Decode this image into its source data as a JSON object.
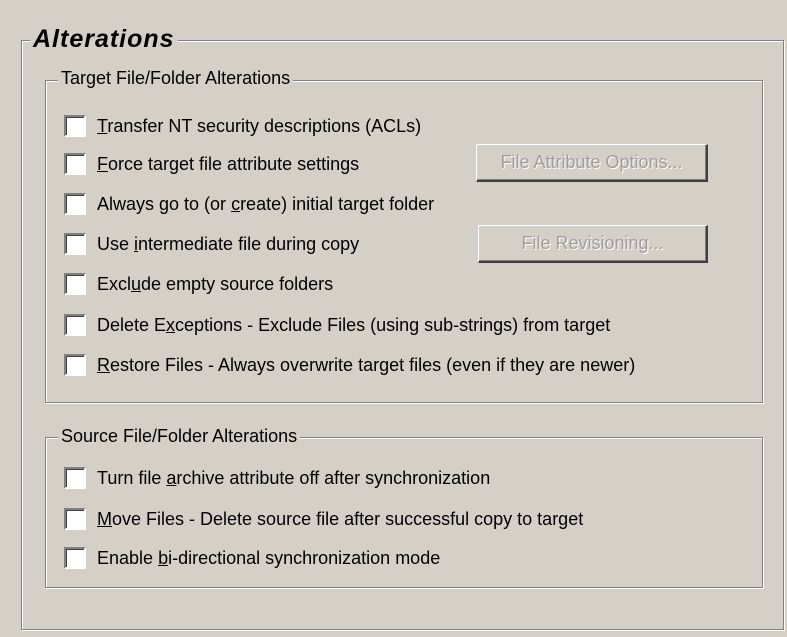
{
  "group_title": "Alterations",
  "target": {
    "title": "Target File/Folder Alterations",
    "options": [
      {
        "pre": "",
        "u": "T",
        "post": "ransfer NT security descriptions (ACLs)",
        "checked": false
      },
      {
        "pre": "",
        "u": "F",
        "post": "orce target file attribute settings",
        "checked": false
      },
      {
        "pre": "Always go to (or ",
        "u": "c",
        "post": "reate) initial target folder",
        "checked": false
      },
      {
        "pre": "Use ",
        "u": "i",
        "post": "ntermediate file during copy",
        "checked": false
      },
      {
        "pre": "Excl",
        "u": "u",
        "post": "de empty source folders",
        "checked": false
      },
      {
        "pre": "Delete E",
        "u": "x",
        "post": "ceptions - Exclude Files (using sub-strings) from target",
        "checked": false
      },
      {
        "pre": "",
        "u": "R",
        "post": "estore Files - Always overwrite target files (even if they are newer)",
        "checked": false
      }
    ],
    "file_attribute_options_button": "File Attribute Options...",
    "file_revisioning_button": "File Revisioning..."
  },
  "source": {
    "title": "Source File/Folder Alterations",
    "options": [
      {
        "pre": "Turn file ",
        "u": "a",
        "post": "rchive attribute off after synchronization",
        "checked": false
      },
      {
        "pre": "",
        "u": "M",
        "post": "ove Files - Delete source file after successful copy to target",
        "checked": false
      },
      {
        "pre": "Enable ",
        "u": "b",
        "post": "i-directional synchronization mode",
        "checked": false
      }
    ]
  },
  "colors": {
    "face": "#d4d0c8",
    "shadow": "#808080",
    "highlight": "#ffffff",
    "disabled_text": "#a09c98"
  }
}
